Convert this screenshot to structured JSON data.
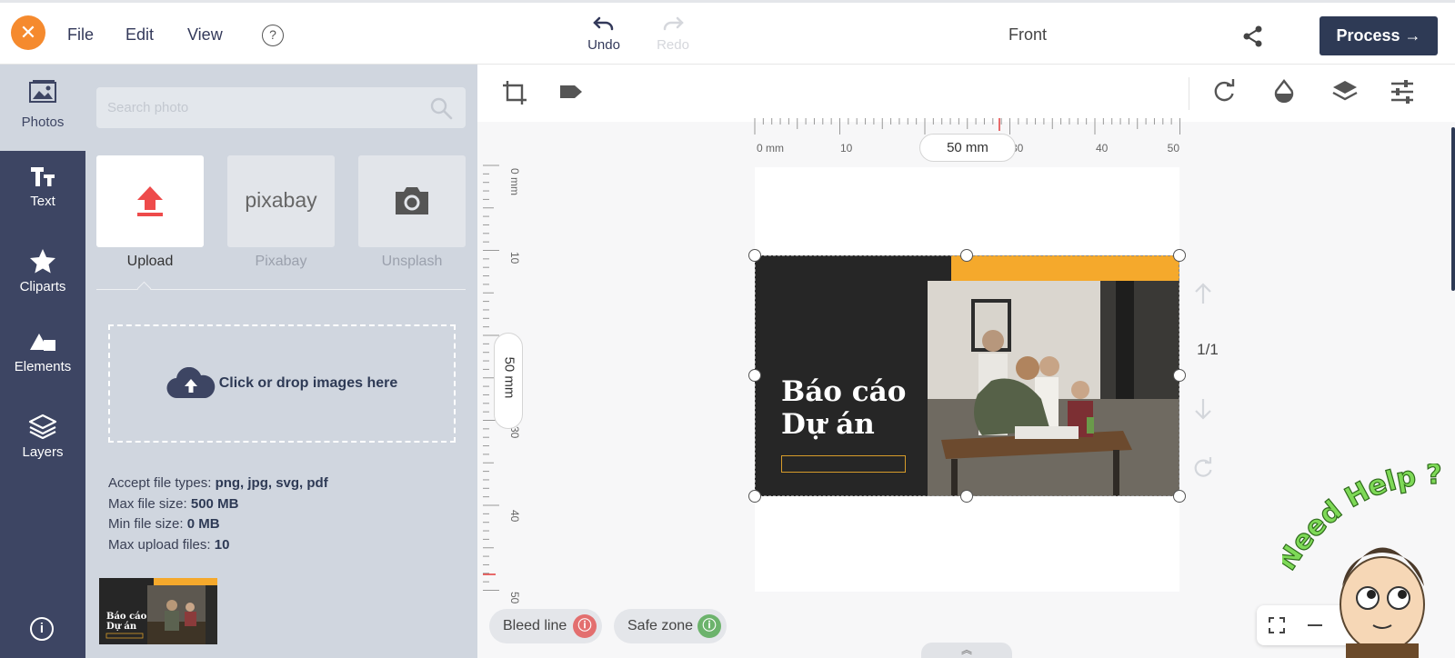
{
  "header": {
    "close_icon": "close-icon",
    "menu": [
      "File",
      "Edit",
      "View"
    ],
    "help_icon": "question-icon",
    "undo_label": "Undo",
    "redo_label": "Redo",
    "side_label": "Front",
    "share_icon": "share-icon",
    "process_label": "Process",
    "accent": "#f58a2e",
    "process_color": "#2e3a55"
  },
  "nav": {
    "items": [
      {
        "label": "Photos",
        "icon": "image-icon"
      },
      {
        "label": "Text",
        "icon": "text-icon"
      },
      {
        "label": "Cliparts",
        "icon": "star-icon"
      },
      {
        "label": "Elements",
        "icon": "shapes-icon"
      },
      {
        "label": "Layers",
        "icon": "layers-icon"
      }
    ],
    "info_icon": "info-icon"
  },
  "panel": {
    "search_placeholder": "Search photo",
    "sources": [
      {
        "label": "Upload",
        "icon": "upload-icon"
      },
      {
        "label": "Pixabay",
        "logo": "pixabay"
      },
      {
        "label": "Unsplash",
        "icon": "camera-icon"
      }
    ],
    "drop_text": "Click or drop images here",
    "file_info": {
      "types_label": "Accept file types:",
      "types_value": "png, jpg, svg, pdf",
      "max_size_label": "Max file size:",
      "max_size_value": "500 MB",
      "min_size_label": "Min file size:",
      "min_size_value": "0 MB",
      "max_files_label": "Max upload files:",
      "max_files_value": "10"
    }
  },
  "canvas": {
    "tools_left": [
      "crop-icon",
      "tag-icon"
    ],
    "tools_right": [
      "rotate-icon",
      "drop-icon",
      "layers-icon",
      "sliders-icon"
    ],
    "ruler_h_labels": [
      "0 mm",
      "10",
      "30",
      "40",
      "50"
    ],
    "ruler_v_labels": [
      "0 mm",
      "10",
      "30",
      "40",
      "50"
    ],
    "width_badge": "50 mm",
    "height_badge": "50 mm",
    "design_title_line1": "Báo cáo",
    "design_title_line2": "Dự án",
    "page_counter": "1/1",
    "bleed_label": "Bleed line",
    "safe_label": "Safe zone",
    "bleed_color": "#e36f6f",
    "safe_color": "#6cb36c",
    "design_orange": "#f5a92c"
  },
  "mascot": {
    "text": "Need Help ?"
  }
}
